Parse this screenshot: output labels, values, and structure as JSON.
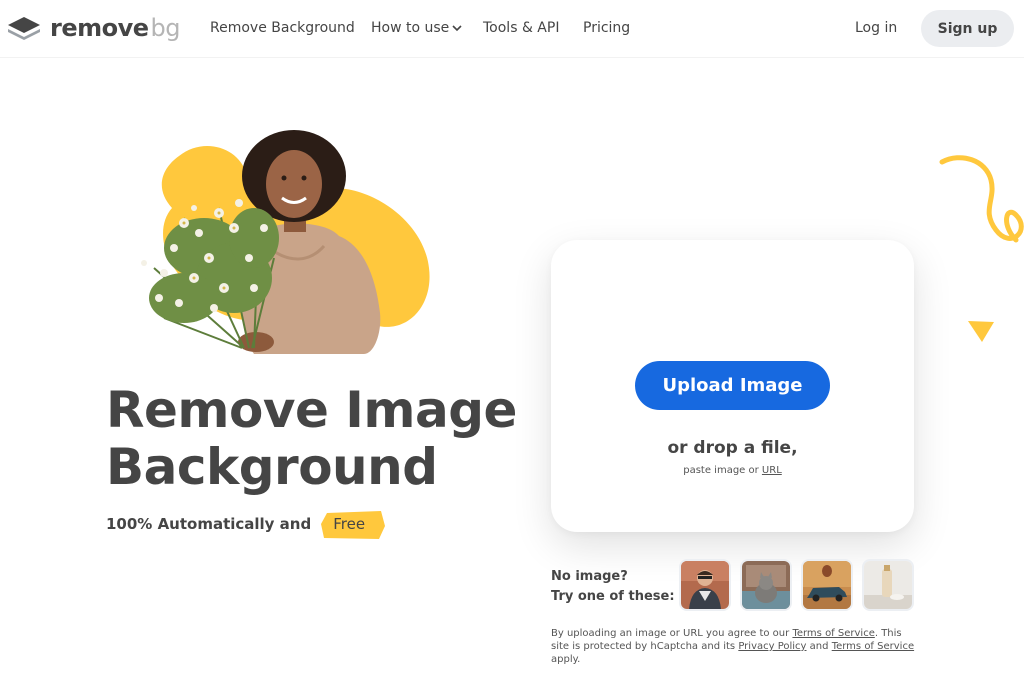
{
  "header": {
    "logo_main": "remove",
    "logo_suffix": "bg",
    "nav": [
      {
        "label": "Remove Background"
      },
      {
        "label": "How to use"
      },
      {
        "label": "Tools & API"
      },
      {
        "label": "Pricing"
      }
    ],
    "login": "Log in",
    "signup": "Sign up"
  },
  "hero": {
    "title_line1": "Remove Image",
    "title_line2": "Background",
    "subtitle": "100% Automatically and",
    "badge": "Free"
  },
  "upload": {
    "button": "Upload Image",
    "drop_text": "or drop a file,",
    "paste_text": "paste image or",
    "url_link": "URL"
  },
  "samples": {
    "line1": "No image?",
    "line2": "Try one of these:",
    "thumbnails": [
      "person-photo",
      "cat-photo",
      "car-photo",
      "bottle-photo"
    ]
  },
  "legal": {
    "part1": "By uploading an image or URL you agree to our",
    "terms1": "Terms of Service",
    "part2": ". This site is protected by hCaptcha and its",
    "privacy": "Privacy Policy",
    "part3": "and",
    "terms2": "Terms of Service",
    "part4": "apply."
  },
  "colors": {
    "accent": "#1769e0",
    "yellow": "#ffc83d",
    "text": "#454545"
  }
}
